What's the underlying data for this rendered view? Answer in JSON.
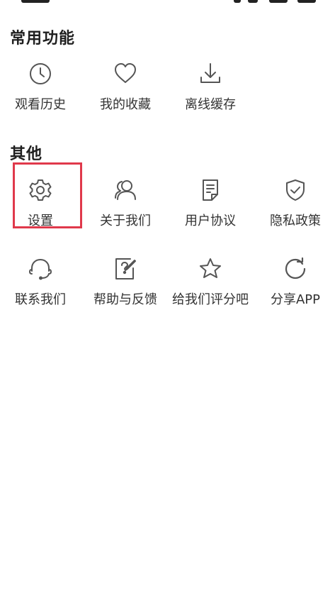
{
  "sections": {
    "common": {
      "title": "常用功能",
      "items": [
        {
          "label": "观看历史",
          "icon": "clock-icon"
        },
        {
          "label": "我的收藏",
          "icon": "heart-icon"
        },
        {
          "label": "离线缓存",
          "icon": "download-icon"
        }
      ]
    },
    "other": {
      "title": "其他",
      "items": [
        {
          "label": "设置",
          "icon": "gear-icon",
          "highlighted": true
        },
        {
          "label": "关于我们",
          "icon": "users-icon"
        },
        {
          "label": "用户协议",
          "icon": "document-icon"
        },
        {
          "label": "隐私政策",
          "icon": "shield-icon"
        },
        {
          "label": "联系我们",
          "icon": "headset-icon"
        },
        {
          "label": "帮助与反馈",
          "icon": "help-edit-icon"
        },
        {
          "label": "给我们评分吧",
          "icon": "star-icon"
        },
        {
          "label": "分享APP",
          "icon": "share-refresh-icon"
        }
      ]
    }
  },
  "colors": {
    "highlight": "#e0394b",
    "icon_stroke": "#555555",
    "text": "#333333"
  }
}
